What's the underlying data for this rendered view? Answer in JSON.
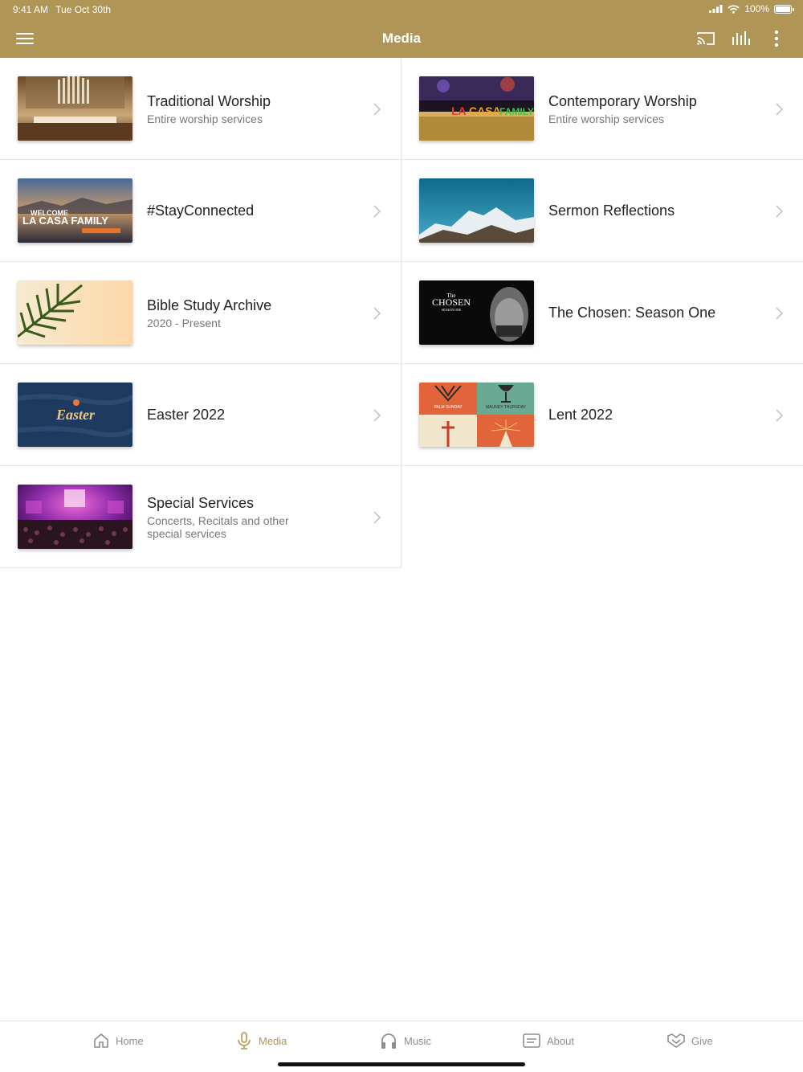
{
  "status": {
    "time": "9:41 AM",
    "date": "Tue Oct 30th",
    "battery": "100%"
  },
  "header": {
    "title": "Media"
  },
  "colors": {
    "accent": "#b09656",
    "tab_inactive": "#8e8e8e"
  },
  "icons": {
    "menu": "hamburger-icon",
    "cast": "cast-icon",
    "audio": "audio-bars-icon",
    "more": "more-vertical-icon"
  },
  "items": [
    {
      "title": "Traditional Worship",
      "subtitle": "Entire worship services",
      "thumb_icon": "cathedral-organ-image"
    },
    {
      "title": "Contemporary Worship",
      "subtitle": "Entire worship services",
      "thumb_icon": "stage-band-image"
    },
    {
      "title": "#StayConnected",
      "subtitle": "",
      "thumb_icon": "welcome-banner-image",
      "thumb_text": "WELCOME",
      "thumb_text2": "LA CASA FAMILY"
    },
    {
      "title": "Sermon Reflections",
      "subtitle": "",
      "thumb_icon": "mountain-image"
    },
    {
      "title": "Bible Study Archive",
      "subtitle": "2020 - Present",
      "thumb_icon": "palm-leaf-image"
    },
    {
      "title": "The Chosen: Season One",
      "subtitle": "",
      "thumb_icon": "the-chosen-image",
      "thumb_text": "The",
      "thumb_text2": "CHOSEN",
      "thumb_text3": "SEASON ONE"
    },
    {
      "title": "Easter 2022",
      "subtitle": "",
      "thumb_icon": "easter-image",
      "thumb_text": "Easter"
    },
    {
      "title": "Lent 2022",
      "subtitle": "",
      "thumb_icon": "lent-tiles-image",
      "thumb_text": "PALM SUNDAY",
      "thumb_text2": "MAUNDY THURSDAY"
    },
    {
      "title": "Special Services",
      "subtitle": "Concerts, Recitals and other special services",
      "thumb_icon": "concert-hall-image"
    }
  ],
  "tabs": [
    {
      "label": "Home",
      "icon": "home-icon",
      "active": false
    },
    {
      "label": "Media",
      "icon": "microphone-icon",
      "active": true
    },
    {
      "label": "Music",
      "icon": "headphones-icon",
      "active": false
    },
    {
      "label": "About",
      "icon": "info-card-icon",
      "active": false
    },
    {
      "label": "Give",
      "icon": "give-icon",
      "active": false
    }
  ]
}
